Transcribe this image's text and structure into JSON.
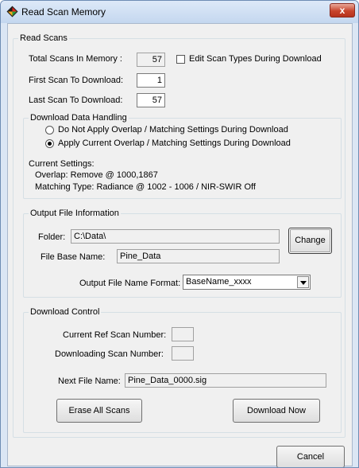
{
  "window": {
    "title": "Read Scan Memory",
    "close_glyph": "x",
    "icon": "app-diamond-icon",
    "close_color": "#c8442c"
  },
  "read_scans": {
    "group_label": "Read Scans",
    "total_label": "Total Scans In Memory :",
    "total_value": "57",
    "edit_types_label": "Edit Scan Types During Download",
    "edit_types_checked": false,
    "first_label": "First Scan To Download:",
    "first_value": "1",
    "last_label": "Last Scan To Download:",
    "last_value": "57"
  },
  "download_handling": {
    "group_label": "Download Data Handling",
    "options": [
      {
        "label": "Do Not Apply Overlap / Matching Settings During Download",
        "selected": false
      },
      {
        "label": "Apply Current Overlap / Matching Settings During Download",
        "selected": true
      }
    ],
    "current_settings_label": "Current Settings:",
    "overlap_text": "Overlap: Remove @ 1000,1867",
    "matching_text": "Matching Type: Radiance @ 1002 - 1006 / NIR-SWIR Off"
  },
  "output_file": {
    "group_label": "Output File Information",
    "folder_label": "Folder:",
    "folder_value": "C:\\Data\\",
    "change_button": "Change",
    "base_label": "File Base Name:",
    "base_value": "Pine_Data",
    "format_label": "Output File Name Format:",
    "format_value": "BaseName_xxxx"
  },
  "download_control": {
    "group_label": "Download Control",
    "current_ref_label": "Current Ref Scan Number:",
    "current_ref_value": "",
    "downloading_label": "Downloading Scan Number:",
    "downloading_value": "",
    "next_file_label": "Next File Name:",
    "next_file_value": "Pine_Data_0000.sig",
    "erase_button": "Erase All Scans",
    "download_button": "Download Now"
  },
  "footer": {
    "cancel_button": "Cancel"
  }
}
